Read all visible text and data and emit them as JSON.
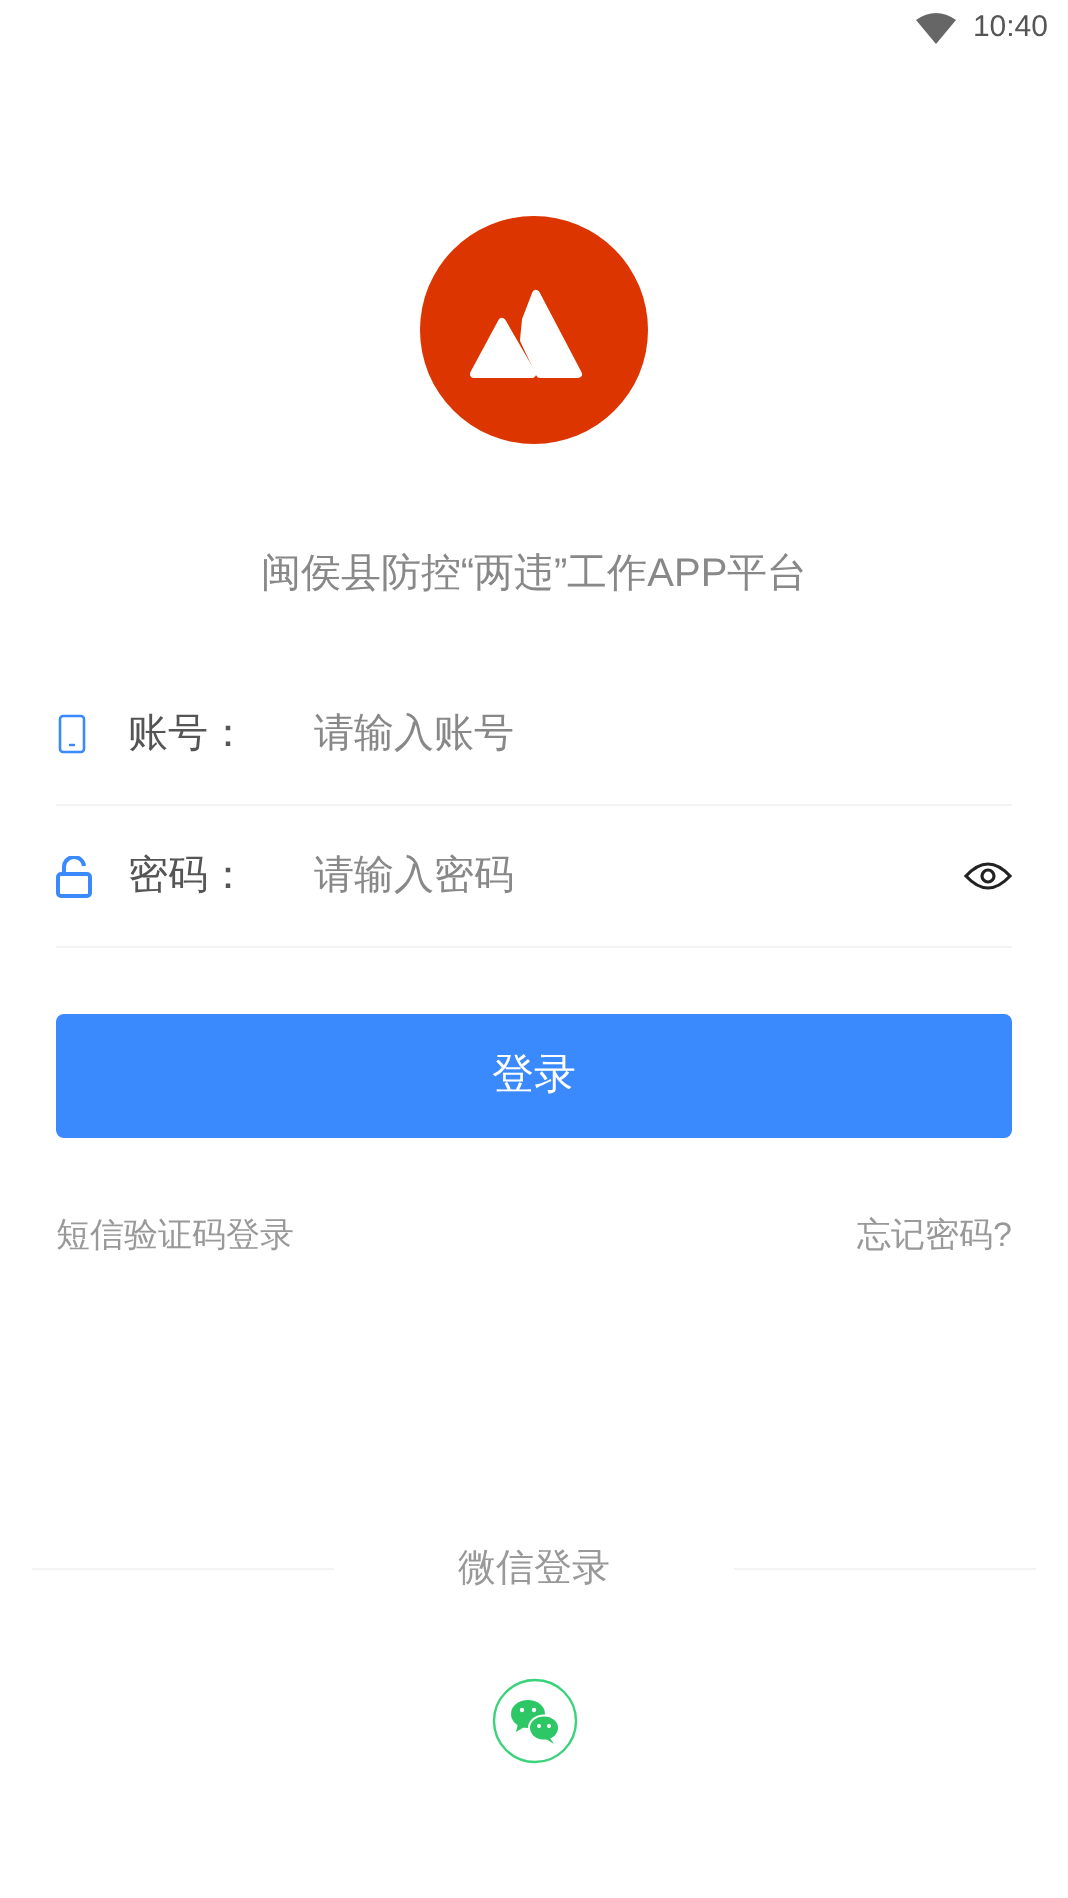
{
  "status_bar": {
    "time": "10:40"
  },
  "app_title": "闽侯县防控“两违”工作APP平台",
  "fields": [
    {
      "kind": "account",
      "label": "账号：",
      "placeholder": "请输入账号"
    },
    {
      "kind": "password",
      "label": "密码：",
      "placeholder": "请输入密码"
    }
  ],
  "login_button": "登录",
  "links": [
    "短信验证码登录",
    "忘记密码?"
  ],
  "wechat": {
    "label": "微信登录"
  }
}
